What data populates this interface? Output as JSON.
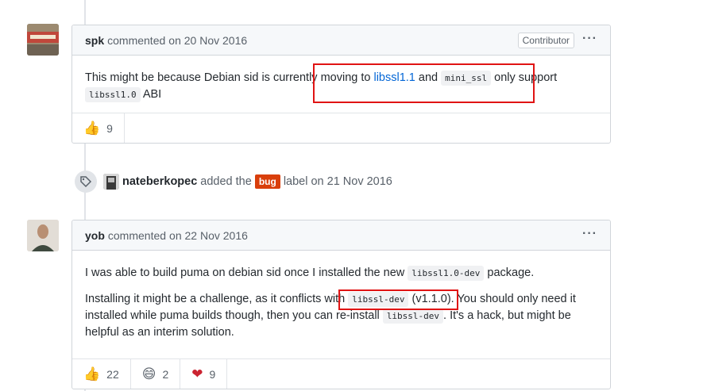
{
  "comment1": {
    "author": "spk",
    "action": "commented",
    "timestamp": "on 20 Nov 2016",
    "badge": "Contributor",
    "more": "···",
    "body": {
      "t1": "This might be because Debian sid is currently moving to ",
      "link": "libssl1.1",
      "t2": " and ",
      "code1": "mini_ssl",
      "t3": " only support",
      "code2": "libssl1.0",
      "t4": " ABI"
    },
    "reactions": [
      {
        "icon": "thumbs-up-icon",
        "glyph": "👍",
        "count": "9"
      }
    ]
  },
  "event": {
    "actor": "nateberkopec",
    "action": "added the",
    "label": "bug",
    "label_color": "#d93f0b",
    "suffix": "label on 21 Nov 2016"
  },
  "comment2": {
    "author": "yob",
    "action": "commented",
    "timestamp": "on 22 Nov 2016",
    "more": "···",
    "body": {
      "p1a": "I was able to build puma on debian sid once I installed the new ",
      "p1code": "libssl1.0-dev",
      "p1b": " package.",
      "p2a": "Installing it might be a challenge, as it conflicts with ",
      "p2code1": "libssl-dev",
      "p2b": " (v1.1.0). You should only need it installed while puma builds though, then you can re-install ",
      "p2code2": "libssl-dev",
      "p2c": ". It's a hack, but might be helpful as an interim solution."
    },
    "reactions": [
      {
        "icon": "thumbs-up-icon",
        "glyph": "👍",
        "count": "22"
      },
      {
        "icon": "laugh-icon",
        "glyph": "😄",
        "count": "2"
      },
      {
        "icon": "heart-icon",
        "glyph": "❤",
        "count": "9"
      }
    ]
  },
  "colors": {
    "link": "#0366d6",
    "highlight": "#e01414",
    "border": "#d1d5da"
  }
}
